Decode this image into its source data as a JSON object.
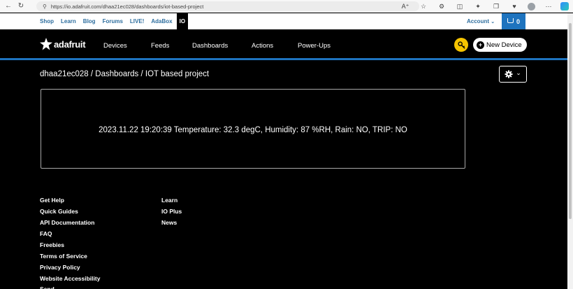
{
  "browser": {
    "url": "https://io.adafruit.com/dhaa21ec028/dashboards/iot-based-project",
    "icons": [
      "back-icon",
      "refresh-icon",
      "lock-icon",
      "read-aloud-icon",
      "favorite-icon",
      "extensions-icon",
      "split-screen-icon",
      "favorites-bar-icon",
      "collections-icon",
      "profile-icon",
      "more-icon",
      "copilot-icon"
    ]
  },
  "top_nav": {
    "links": [
      "Shop",
      "Learn",
      "Blog",
      "Forums",
      "LIVE!",
      "AdaBox",
      "IO"
    ],
    "account_label": "Account",
    "cart_count": "0"
  },
  "main_nav": {
    "logo_text": "adafruit",
    "items": [
      "Devices",
      "Feeds",
      "Dashboards",
      "Actions",
      "Power-Ups"
    ],
    "new_device_label": "New Device"
  },
  "page": {
    "breadcrumb": "dhaa21ec028 / Dashboards / IOT based project",
    "block_text": "2023.11.22 19:20:39 Temperature: 32.3 degC, Humidity:  87 %RH, Rain: NO, TRIP: NO"
  },
  "footer": {
    "col1": [
      "Get Help",
      "Quick Guides",
      "API Documentation",
      "FAQ",
      "Freebies",
      "Terms of Service",
      "Privacy Policy",
      "Website Accessibility"
    ],
    "col2": [
      "Learn",
      "IO Plus",
      "News"
    ],
    "cut_text": "Send Feedback"
  },
  "colors": {
    "accent_blue": "#1e73be",
    "key_yellow": "#f6c400",
    "link_blue": "#2f6f9f"
  }
}
